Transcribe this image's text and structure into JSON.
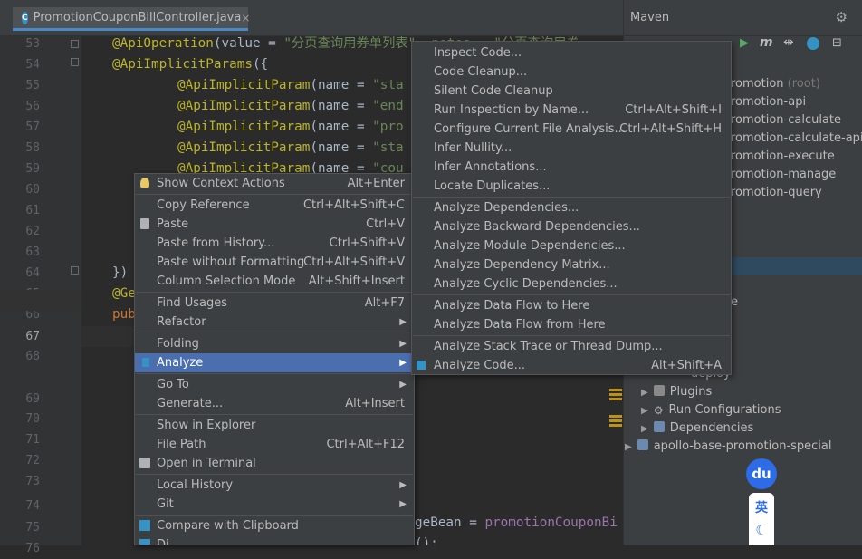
{
  "tab": {
    "file_name": "PromotionCouponBillController.java",
    "close": "×"
  },
  "gutter": {
    "line_numbers": [
      "53",
      "54",
      "55",
      "56",
      "57",
      "58",
      "59",
      "60",
      "61",
      "62",
      "63",
      "64",
      "65",
      "66",
      "67",
      "68",
      "69",
      "70",
      "71",
      "72",
      "73",
      "74",
      "75",
      "76"
    ]
  },
  "code": {
    "line53": {
      "ann": "@ApiOperation",
      "p1": "(",
      "kw1": "value",
      "p2": " = ",
      "s1": "\"分页查询用券单列表\"",
      "rest": ", notes = \"分页查询用券"
    },
    "line54": {
      "ann": "@ApiImplicitParams",
      "p1": "({"
    },
    "line55": {
      "ann": "@ApiImplicitParam",
      "p1": "(",
      "kw": "name",
      "p2": " = ",
      "s": "\"sta"
    },
    "line56": {
      "ann": "@ApiImplicitParam",
      "p1": "(",
      "kw": "name",
      "p2": " = ",
      "s": "\"end"
    },
    "line57": {
      "ann": "@ApiImplicitParam",
      "p1": "(",
      "kw": "name",
      "p2": " = ",
      "s": "\"pro"
    },
    "line58": {
      "ann": "@ApiImplicitParam",
      "p1": "(",
      "kw": "name",
      "p2": " = ",
      "s": "\"sta"
    },
    "line59": {
      "ann": "@ApiImplicitParam",
      "p1": "(",
      "kw": "name",
      "p2": " = ",
      "s": "\"cou"
    },
    "line64": {
      "text": "})"
    },
    "line65": {
      "ann": "@Ge"
    },
    "line66": {
      "kw": "pub"
    },
    "line76": {
      "a": "geBean = ",
      "b": "promotionCouponBi"
    },
    "line77": {
      "a": "(",
      "b": ");"
    }
  },
  "maven": {
    "title": "Maven",
    "tree": [
      {
        "label": "romotion",
        "extra": " (root)"
      },
      {
        "label": "romotion-api"
      },
      {
        "label": "romotion-calculate"
      },
      {
        "label": "romotion-calculate-api"
      },
      {
        "label": "romotion-execute"
      },
      {
        "label": "romotion-manage"
      },
      {
        "label": "romotion-query"
      },
      {
        "label": "e"
      },
      {
        "label": "deploy"
      },
      {
        "label": "Plugins"
      },
      {
        "label": "Run Configurations"
      },
      {
        "label": "Dependencies"
      },
      {
        "label": "apollo-base-promotion-special"
      }
    ]
  },
  "context_menu": {
    "items": [
      {
        "label": "Show Context Actions",
        "shortcut": "Alt+Enter"
      },
      {
        "label": "Copy Reference",
        "shortcut": "Ctrl+Alt+Shift+C"
      },
      {
        "label": "Paste",
        "shortcut": "Ctrl+V"
      },
      {
        "label": "Paste from History...",
        "shortcut": "Ctrl+Shift+V"
      },
      {
        "label": "Paste without Formatting",
        "shortcut": "Ctrl+Alt+Shift+V"
      },
      {
        "label": "Column Selection Mode",
        "shortcut": "Alt+Shift+Insert"
      },
      {
        "label": "Find Usages",
        "shortcut": "Alt+F7"
      },
      {
        "label": "Refactor",
        "shortcut": ""
      },
      {
        "label": "Folding",
        "shortcut": ""
      },
      {
        "label": "Analyze",
        "shortcut": ""
      },
      {
        "label": "Go To",
        "shortcut": ""
      },
      {
        "label": "Generate...",
        "shortcut": "Alt+Insert"
      },
      {
        "label": "Show in Explorer",
        "shortcut": ""
      },
      {
        "label": "File Path",
        "shortcut": "Ctrl+Alt+F12"
      },
      {
        "label": "Open in Terminal",
        "shortcut": ""
      },
      {
        "label": "Local History",
        "shortcut": ""
      },
      {
        "label": "Git",
        "shortcut": ""
      },
      {
        "label": "Compare with Clipboard",
        "shortcut": ""
      },
      {
        "label": "Di",
        "shortcut": ""
      }
    ]
  },
  "analyze_submenu": {
    "items": [
      {
        "label": "Inspect Code...",
        "shortcut": ""
      },
      {
        "label": "Code Cleanup...",
        "shortcut": ""
      },
      {
        "label": "Silent Code Cleanup",
        "shortcut": ""
      },
      {
        "label": "Run Inspection by Name...",
        "shortcut": "Ctrl+Alt+Shift+I"
      },
      {
        "label": "Configure Current File Analysis...",
        "shortcut": "Ctrl+Alt+Shift+H"
      },
      {
        "label": "Infer Nullity...",
        "shortcut": ""
      },
      {
        "label": "Infer Annotations...",
        "shortcut": ""
      },
      {
        "label": "Locate Duplicates...",
        "shortcut": ""
      },
      {
        "label": "Analyze Dependencies...",
        "shortcut": ""
      },
      {
        "label": "Analyze Backward Dependencies...",
        "shortcut": ""
      },
      {
        "label": "Analyze Module Dependencies...",
        "shortcut": ""
      },
      {
        "label": "Analyze Dependency Matrix...",
        "shortcut": ""
      },
      {
        "label": "Analyze Cyclic Dependencies...",
        "shortcut": ""
      },
      {
        "label": "Analyze Data Flow to Here",
        "shortcut": ""
      },
      {
        "label": "Analyze Data Flow from Here",
        "shortcut": ""
      },
      {
        "label": "Analyze Stack Trace or Thread Dump...",
        "shortcut": ""
      },
      {
        "label": "Analyze Code...",
        "shortcut": "Alt+Shift+A"
      }
    ]
  },
  "ime": {
    "logo": "du",
    "lang": "英",
    "moon": "☾"
  }
}
